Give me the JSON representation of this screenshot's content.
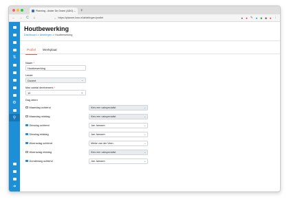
{
  "browser": {
    "tab_title": "Planning - Ander De Groen (ADG) — ×",
    "new_tab": "+",
    "url": "https://planner.kwn.nl/afdelingen/profiel",
    "back": "←",
    "forward": "→",
    "reload": "C",
    "home": "⌂"
  },
  "colors": {
    "brand": "#1d8fd6",
    "accent_tab": "#e05a3a"
  },
  "page": {
    "title": "Houtbewerking",
    "breadcrumb": {
      "root": "Dashboard",
      "sep": ">",
      "parent": "Afdelingen",
      "current": "Houtbewerking"
    }
  },
  "tabs": {
    "profiel": "Profiel",
    "werkplaat": "Werkplaat"
  },
  "form": {
    "naam_label": "Naam",
    "naam_value": "Houtbewerking",
    "leider_label": "Leider",
    "leider_value": "Docent",
    "max_label": "Max aantal deelnemers",
    "max_value": "10",
    "dagdelen_label": "Dag delen",
    "required_mark": "*"
  },
  "days": [
    {
      "label": "Maandag ochtend",
      "checked": false,
      "teacher": "Kies een vakspecialist",
      "placeholder": true
    },
    {
      "label": "Maandag middag",
      "checked": false,
      "teacher": "Kies een vakspecialist",
      "placeholder": true
    },
    {
      "label": "Dinsdag ochtend",
      "checked": true,
      "teacher": "Jan Janssen",
      "placeholder": false
    },
    {
      "label": "Dinsdag middag",
      "checked": true,
      "teacher": "Jan Janssen",
      "placeholder": false
    },
    {
      "label": "Woensdag ochtend",
      "checked": true,
      "teacher": "Mieke van der Veen",
      "placeholder": false
    },
    {
      "label": "Woensdag middag",
      "checked": false,
      "teacher": "Kies een vakspecialist",
      "placeholder": true
    },
    {
      "label": "Donderdag ochtend",
      "checked": true,
      "teacher": "Jan Janssen",
      "placeholder": false
    }
  ],
  "sidebar": {
    "icons": [
      "dashboard-icon",
      "calendar-icon",
      "list-icon",
      "users-icon",
      "sort-icon",
      "grid-icon",
      "car-icon",
      "building-icon",
      "table-icon",
      "chart-icon",
      "settings-icon",
      "people-icon",
      "pin-icon"
    ],
    "bottom_icons": [
      "grid-small-icon",
      "user-icon",
      "logout-icon",
      "arrow-icon"
    ]
  }
}
